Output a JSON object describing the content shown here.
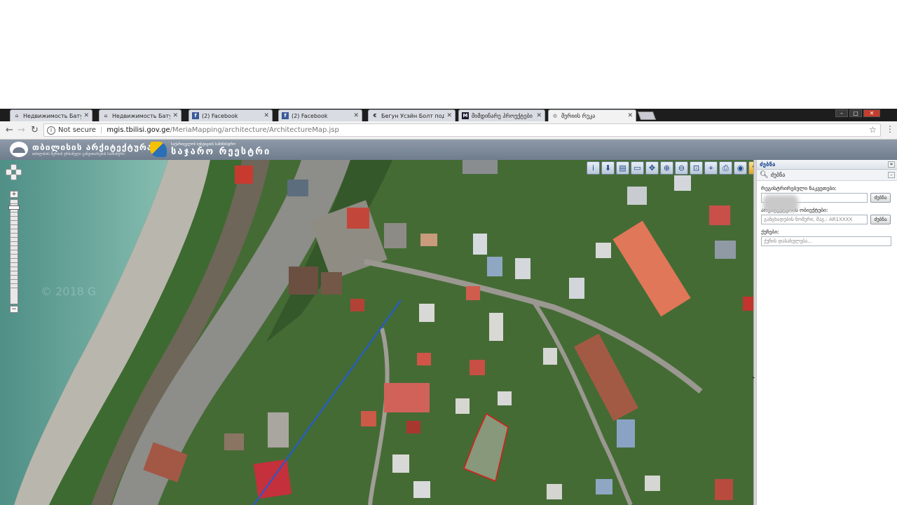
{
  "tabs": [
    {
      "title": "Недвижимость Батуми",
      "icon": "house-icon",
      "active": false
    },
    {
      "title": "Недвижимость Батуми",
      "icon": "house-icon",
      "active": false
    },
    {
      "title": "(2) Facebook",
      "icon": "facebook-icon",
      "active": false
    },
    {
      "title": "(2) Facebook",
      "icon": "facebook-icon",
      "active": false
    },
    {
      "title": "Бегун Усэйн Болт подпи",
      "icon": "e-icon",
      "active": false
    },
    {
      "title": "მიმდინარე პროექტები",
      "icon": "m-icon",
      "active": false
    },
    {
      "title": "მერიის რუკა",
      "icon": "globe-icon",
      "active": true
    }
  ],
  "address": {
    "security": "Not secure",
    "host": "mgis.tbilisi.gov.ge",
    "path": "/MeriaMapping/architecture/ArchitectureMap.jsp"
  },
  "header": {
    "logo1_title": "თბილისის არქიტექტურა",
    "logo1_sub": "თბილისის მერიის ურბანული განვითარების სამსახური",
    "logo2_top": "საქართველოს იუსტიციის სამინისტრო",
    "logo2_title": "საჯარო რეესტრი"
  },
  "map": {
    "watermark": "© 2018 G",
    "tools": [
      "info-icon",
      "download-icon",
      "layers-icon",
      "ruler-icon",
      "pan-icon",
      "zoom-in-icon",
      "zoom-out-icon",
      "zoom-box-icon",
      "select-icon",
      "print-icon",
      "globe-icon",
      "edit-icon"
    ]
  },
  "panel": {
    "title": "ძებნა",
    "search_header": "ძებნა",
    "field1_label": "რეგისტრირებული ნაკვეთები:",
    "field1_value": "",
    "field2_label": "არქიტექტურის ობიექტები:",
    "field2_placeholder": "განცხადების ნომერი, მაგ.: AR1XXXX",
    "field3_label": "ქუჩები:",
    "field3_placeholder": "ქუჩის დასახელება...",
    "search_button": "ძებნა"
  }
}
